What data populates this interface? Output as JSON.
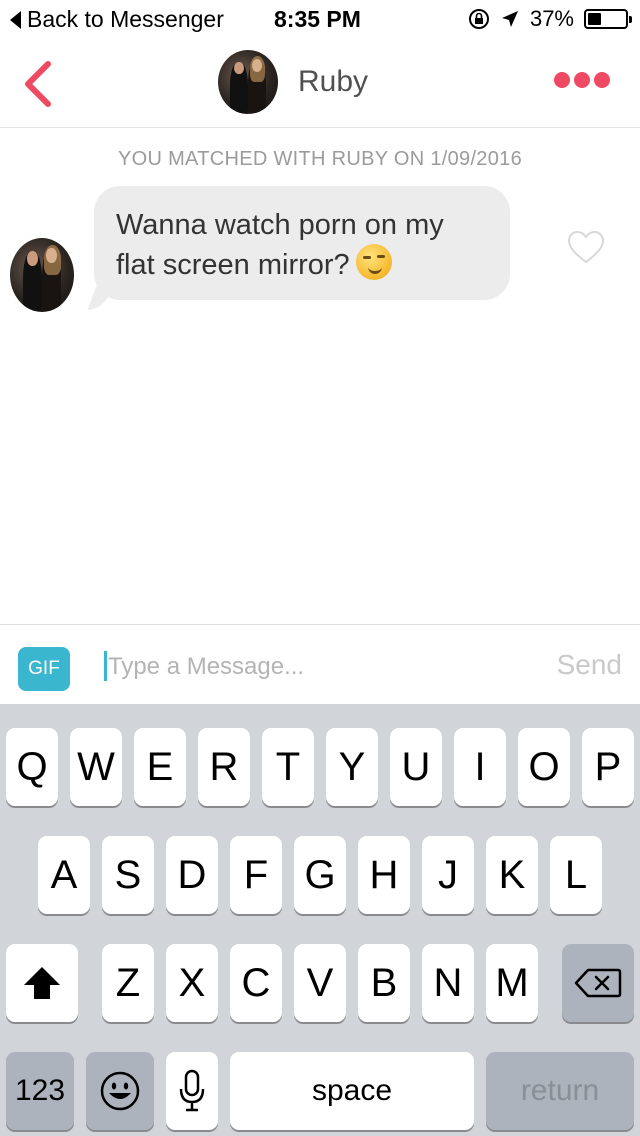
{
  "status_bar": {
    "back_label": "Back to Messenger",
    "time": "8:35 PM",
    "battery": "37%",
    "battery_level": 0.37
  },
  "header": {
    "name": "Ruby"
  },
  "chat": {
    "match_banner": "YOU MATCHED WITH RUBY ON 1/09/2016",
    "message_text": "Wanna watch porn on my flat screen mirror?"
  },
  "composer": {
    "gif_label": "GIF",
    "placeholder": "Type a Message...",
    "send_label": "Send"
  },
  "keyboard": {
    "row1": [
      "Q",
      "W",
      "E",
      "R",
      "T",
      "Y",
      "U",
      "I",
      "O",
      "P"
    ],
    "row2": [
      "A",
      "S",
      "D",
      "F",
      "G",
      "H",
      "J",
      "K",
      "L"
    ],
    "row3": [
      "Z",
      "X",
      "C",
      "V",
      "B",
      "N",
      "M"
    ],
    "numbers_label": "123",
    "space_label": "space",
    "return_label": "return"
  }
}
